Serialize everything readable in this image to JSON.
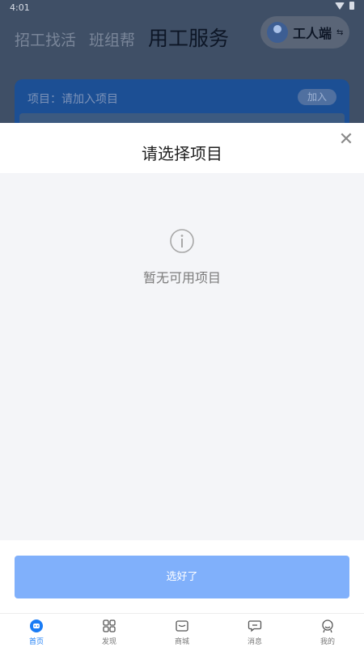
{
  "status_bar": {
    "time": "4:01"
  },
  "header": {
    "tabs": [
      {
        "label": "招工找活"
      },
      {
        "label": "班组帮"
      },
      {
        "label": "用工服务"
      }
    ],
    "role_switch": {
      "label": "工人端",
      "arrow": "⇆"
    }
  },
  "project_card": {
    "label": "项目：请加入项目",
    "join_label": "加入"
  },
  "sheet": {
    "title": "请选择项目",
    "close_glyph": "✕",
    "empty_text": "暂无可用项目",
    "confirm_label": "选好了"
  },
  "bottom_nav": {
    "items": [
      {
        "label": "首页",
        "icon": "home-icon"
      },
      {
        "label": "发现",
        "icon": "grid-icon"
      },
      {
        "label": "商城",
        "icon": "shop-icon"
      },
      {
        "label": "消息",
        "icon": "message-icon"
      },
      {
        "label": "我的",
        "icon": "profile-icon"
      }
    ]
  },
  "colors": {
    "accent": "#1a7cf5",
    "confirm_button": "#80b0fb",
    "overlay_bg": "#3f4f66"
  }
}
